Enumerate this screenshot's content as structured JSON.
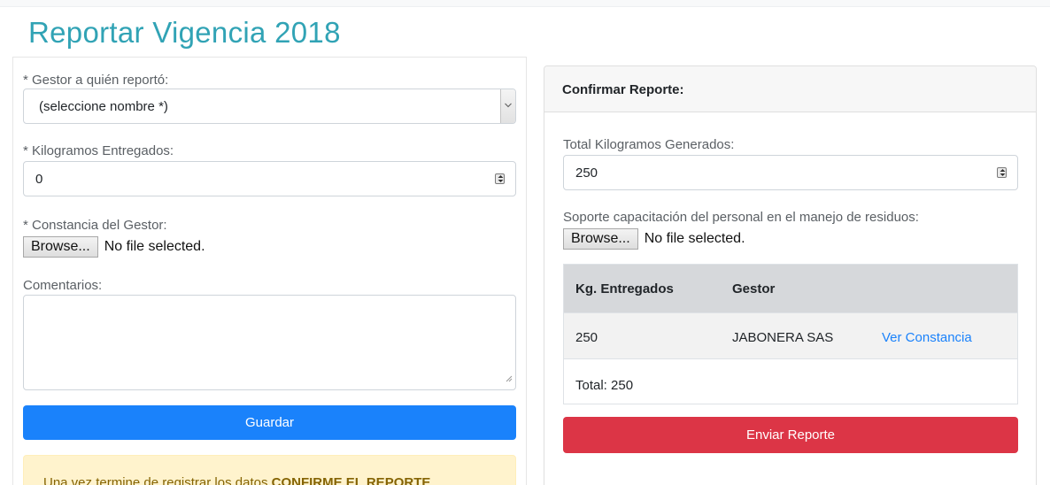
{
  "page": {
    "title": "Reportar Vigencia 2018"
  },
  "form": {
    "gestor_label": "* Gestor a quién reportó:",
    "gestor_selected": "(seleccione nombre *)",
    "kilos_label": "* Kilogramos Entregados:",
    "kilos_value": "0",
    "constancia_label": "* Constancia del Gestor:",
    "browse_label": "Browse...",
    "no_file_text": "No file selected.",
    "comentarios_label": "Comentarios:",
    "comentarios_value": "",
    "save_label": "Guardar",
    "alert_text": "Una vez termine de registrar los datos ",
    "alert_strong": "CONFIRME EL REPORTE",
    "alert_end": "."
  },
  "confirm": {
    "header": "Confirmar Reporte:",
    "total_label": "Total Kilogramos Generados:",
    "total_value": "250",
    "soporte_label": "Soporte capacitación del personal en el manejo de residuos:",
    "browse_label": "Browse...",
    "no_file_text": "No file selected.",
    "table": {
      "headers": [
        "Kg. Entregados",
        "Gestor"
      ],
      "rows": [
        {
          "kg": "250",
          "gestor": "JABONERA SAS",
          "link": "Ver Constancia"
        }
      ],
      "total": "Total: 250"
    },
    "send_label": "Enviar Reporte"
  },
  "colors": {
    "title": "#31a3b5",
    "primary": "#1a82fb",
    "danger": "#dc3546",
    "warning_bg": "#fff3cd",
    "warning_text": "#856404"
  }
}
